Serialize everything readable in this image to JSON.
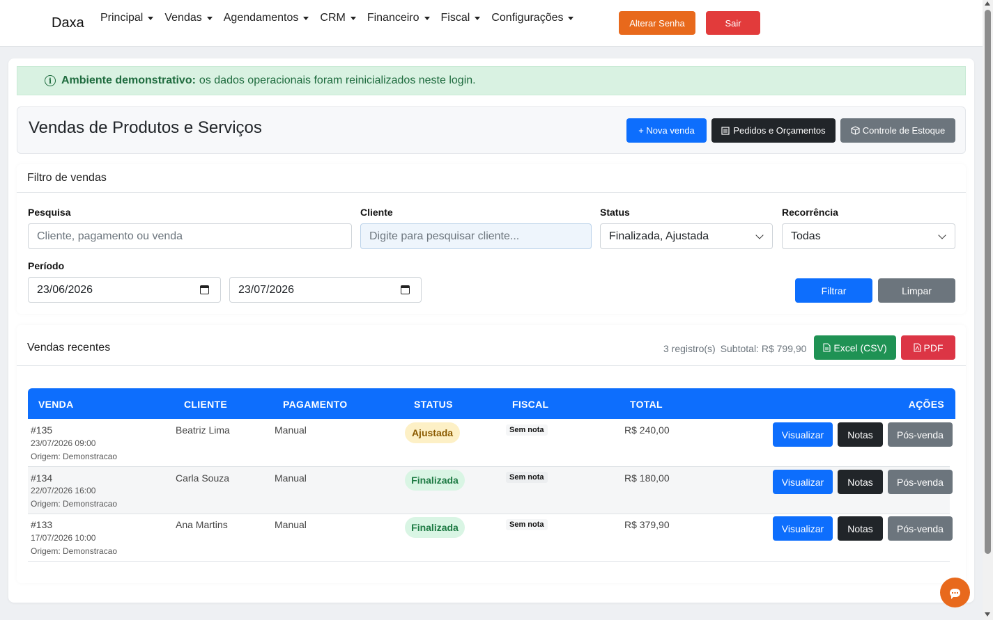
{
  "nav": {
    "brand": "Daxa",
    "menu": [
      "Principal",
      "Vendas",
      "Agendamentos",
      "CRM",
      "Financeiro",
      "Fiscal",
      "Configurações"
    ],
    "change_password": "Alterar Senha",
    "logout": "Sair"
  },
  "alert": {
    "strong": "Ambiente demonstrativo:",
    "text": "os dados operacionais foram reinicializados neste login."
  },
  "header": {
    "title": "Vendas de Produtos e Serviços",
    "new_sale": "+ Nova venda",
    "orders": "Pedidos e Orçamentos",
    "stock": "Controle de Estoque"
  },
  "filter": {
    "title": "Filtro de vendas",
    "search_label": "Pesquisa",
    "search_placeholder": "Cliente, pagamento ou venda",
    "client_label": "Cliente",
    "client_placeholder": "Digite para pesquisar cliente...",
    "status_label": "Status",
    "status_value": "Finalizada, Ajustada",
    "recurrence_label": "Recorrência",
    "recurrence_value": "Todas",
    "period_label": "Período",
    "date_from": "23/06/2026",
    "date_to": "23/07/2026",
    "filter_button": "Filtrar",
    "clear_button": "Limpar"
  },
  "sales": {
    "title": "Vendas recentes",
    "records": "3 registro(s)",
    "subtotal": "Subtotal: R$ 799,90",
    "excel": "Excel (CSV)",
    "pdf": "PDF",
    "columns": [
      "VENDA",
      "CLIENTE",
      "PAGAMENTO",
      "STATUS",
      "FISCAL",
      "TOTAL",
      "AÇÕES"
    ],
    "rows": [
      {
        "id": "#135",
        "date": "23/07/2026 09:00",
        "origin": "Origem: Demonstracao",
        "client": "Beatriz Lima",
        "payment": "Manual",
        "status": "Ajustada",
        "fiscal": "Sem nota",
        "total": "R$ 240,00"
      },
      {
        "id": "#134",
        "date": "22/07/2026 16:00",
        "origin": "Origem: Demonstracao",
        "client": "Carla Souza",
        "payment": "Manual",
        "status": "Finalizada",
        "fiscal": "Sem nota",
        "total": "R$ 180,00"
      },
      {
        "id": "#133",
        "date": "17/07/2026 10:00",
        "origin": "Origem: Demonstracao",
        "client": "Ana Martins",
        "payment": "Manual",
        "status": "Finalizada",
        "fiscal": "Sem nota",
        "total": "R$ 379,90"
      }
    ],
    "actions": {
      "view": "Visualizar",
      "notes": "Notas",
      "after_sale": "Pós-venda"
    }
  },
  "colors": {
    "primary": "#0d6efd",
    "orange": "#e8691c",
    "danger": "#e23b3b",
    "success": "#1f9254",
    "dark": "#212529",
    "secondary": "#6c757d"
  }
}
